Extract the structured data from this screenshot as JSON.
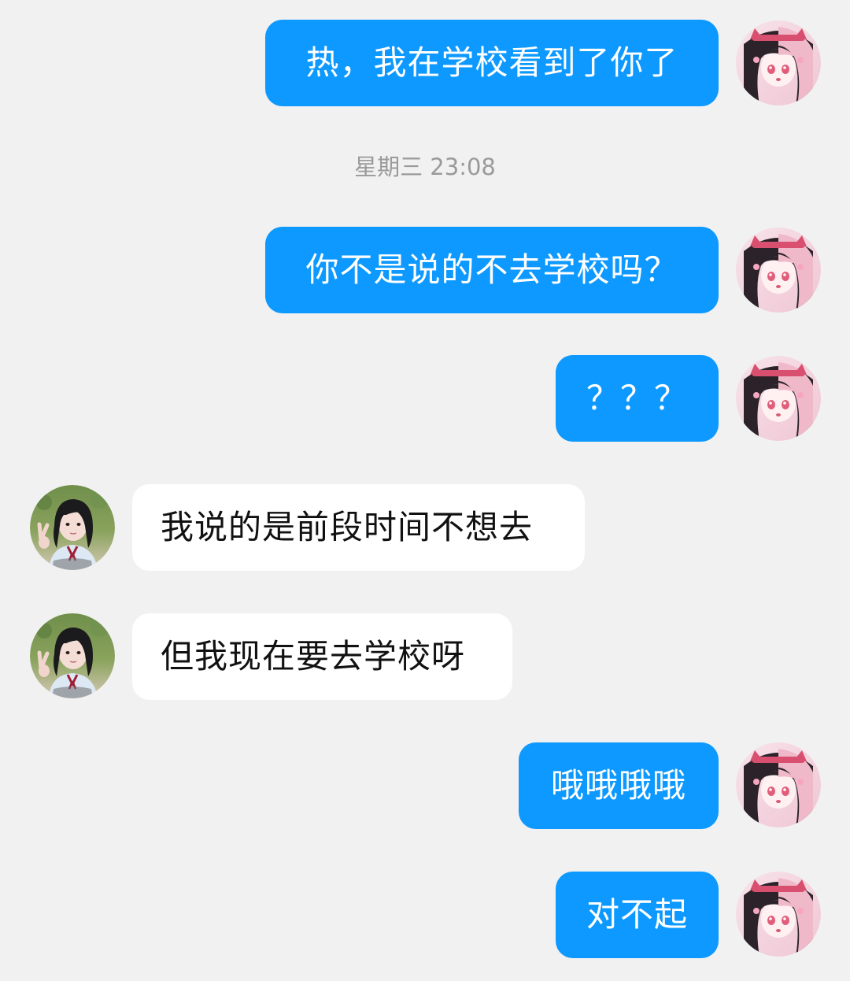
{
  "conversation": {
    "timestamp": "星期三 23:08",
    "messages": [
      {
        "sender": "me",
        "text": "热，我在学校看到了你了"
      },
      {
        "sender": "me",
        "text": "你不是说的不去学校吗？"
      },
      {
        "sender": "me",
        "text": "？？？"
      },
      {
        "sender": "other",
        "text": "我说的是前段时间不想去"
      },
      {
        "sender": "other",
        "text": "但我现在要去学校呀"
      },
      {
        "sender": "me",
        "text": "哦哦哦哦"
      },
      {
        "sender": "me",
        "text": "对不起"
      }
    ]
  },
  "theme": {
    "background": "#f1f1f1",
    "outgoing_bubble": "#0d99ff",
    "incoming_bubble": "#ffffff",
    "timestamp_color": "#9a9a9a"
  },
  "avatars": {
    "me": "anime-girl-avatar",
    "other": "schoolgirl-photo-avatar"
  }
}
